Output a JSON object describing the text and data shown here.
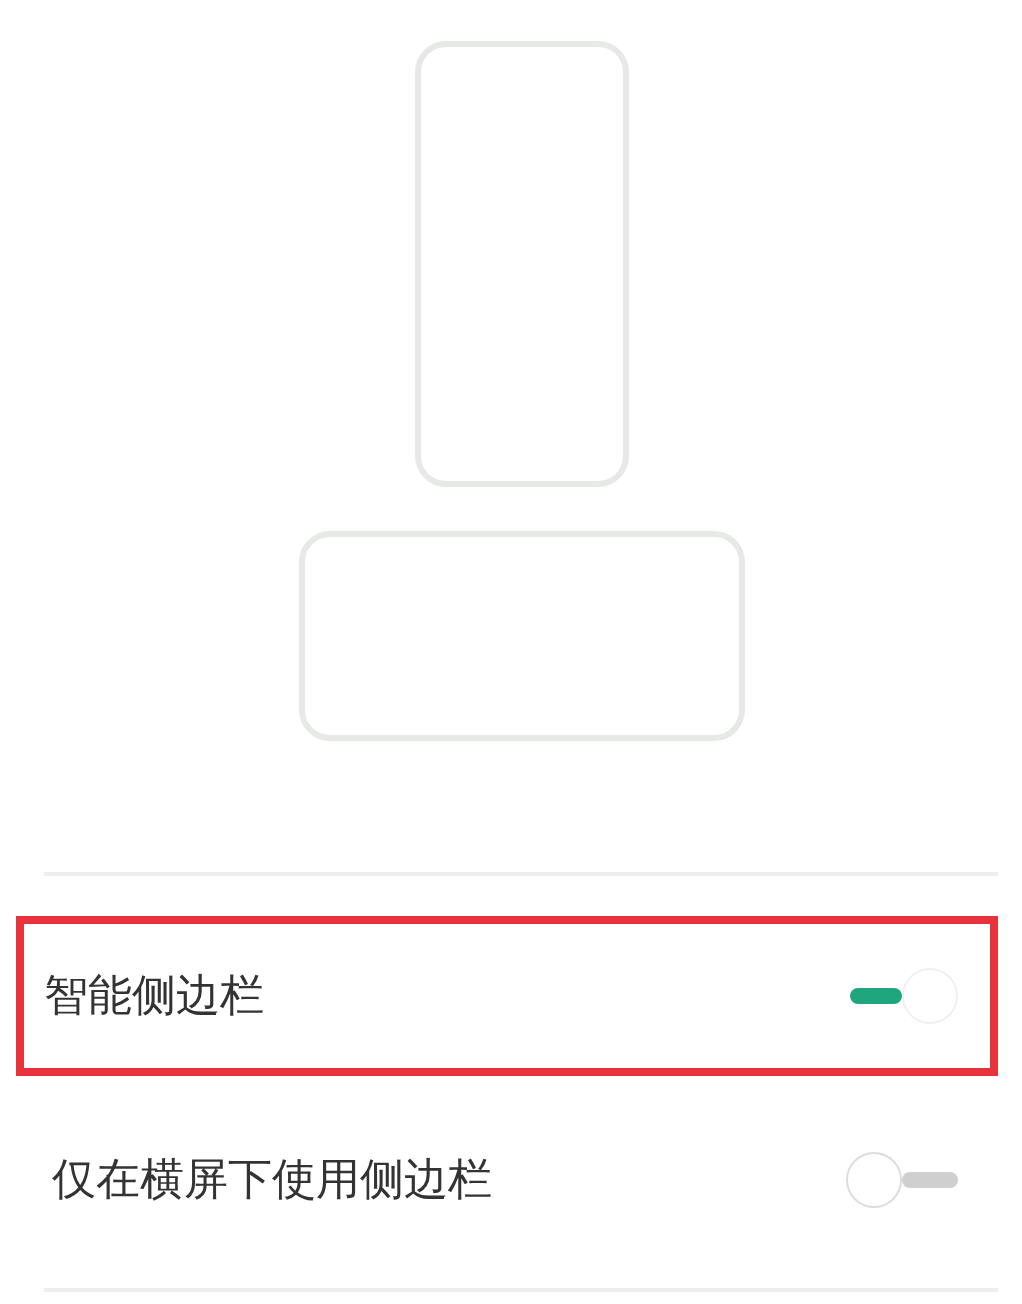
{
  "settings": [
    {
      "label": "智能侧边栏",
      "on": true,
      "highlighted": true
    },
    {
      "label": "仅在横屏下使用侧边栏",
      "on": false,
      "highlighted": false
    }
  ]
}
